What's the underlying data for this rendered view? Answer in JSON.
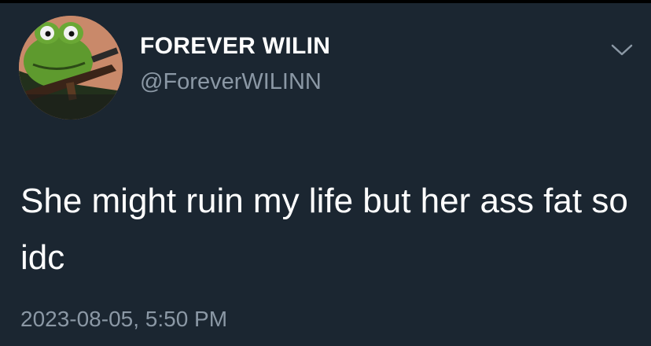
{
  "tweet": {
    "author": {
      "display_name": "FOREVER WILIN",
      "handle": "@ForeverWILINN",
      "avatar_icon": "kermit-avatar-icon"
    },
    "menu_icon": "chevron-down-icon",
    "text": "She might ruin my life but her ass fat so idc",
    "timestamp": "2023-08-05, 5:50 PM"
  },
  "colors": {
    "background": "#1b2631",
    "primary_text": "#ffffff",
    "secondary_text": "#8b98a5",
    "avatar_background": "#c9896a"
  }
}
